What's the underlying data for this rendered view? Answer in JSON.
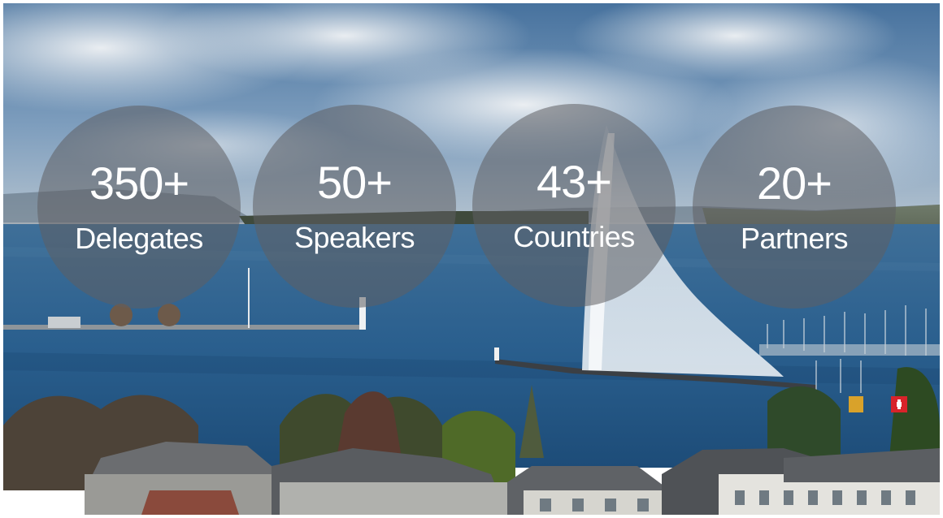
{
  "stats": [
    {
      "value": "350+",
      "label": "Delegates"
    },
    {
      "value": "50+",
      "label": "Speakers"
    },
    {
      "value": "43+",
      "label": "Countries"
    },
    {
      "value": "20+",
      "label": "Partners"
    }
  ],
  "colors": {
    "sky_top": "#4f7fad",
    "cloud": "#dfe5ea",
    "lake": "#2f6593",
    "lake_deep": "#1f4f7c",
    "shore": "#3d3f34",
    "roof": "#5b5f63",
    "circle_fill": "#5f5f62",
    "text": "#ffffff"
  }
}
